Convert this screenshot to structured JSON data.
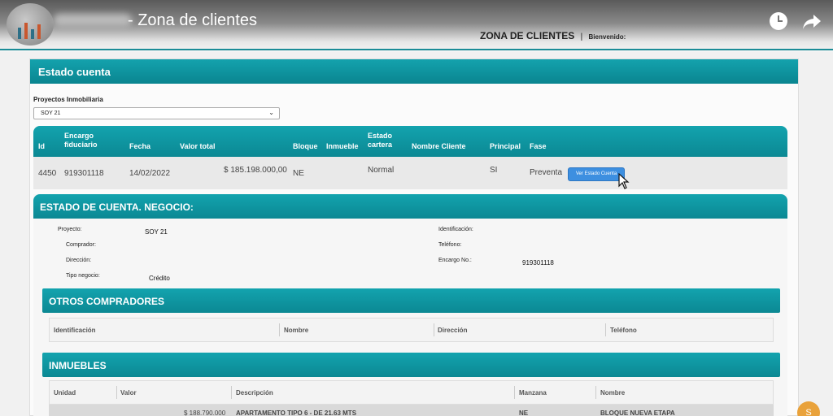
{
  "video": {
    "title": "- Zona de clientes"
  },
  "header": {
    "section": "ZONA DE CLIENTES",
    "separator": "|",
    "welcome": "Bienvenido:"
  },
  "card": {
    "title": "Estado cuenta",
    "projects_label": "Proyectos Inmobiliaria",
    "selected_project": "SOY 21"
  },
  "results": {
    "columns": [
      "Id",
      "Encargo fiduciario",
      "Fecha",
      "Valor total",
      "Bloque",
      "Inmueble",
      "Estado cartera",
      "Nombre Cliente",
      "Principal",
      "Fase"
    ],
    "row": {
      "id": "4450",
      "encargo": "919301118",
      "fecha": "14/02/2022",
      "valor": "$ 185.198.000,00",
      "bloque": "NE",
      "estado": "Normal",
      "principal": "SI",
      "fase": "Preventa"
    },
    "button": "Ver Estado Cuenta"
  },
  "estado": {
    "title": "ESTADO DE CUENTA. NEGOCIO:",
    "labels": {
      "proyecto": "Proyecto:",
      "comprador": "Comprador:",
      "direccion": "Dirección:",
      "tipo": "Tipo negocio:",
      "identificacion": "Identificación:",
      "telefono": "Teléfono:",
      "encargo": "Encargo No.:"
    },
    "values": {
      "proyecto": "SOY 21",
      "tipo": "Crédito",
      "encargo": "919301118"
    }
  },
  "otros": {
    "title": "OTROS COMPRADORES",
    "columns": [
      "Identificación",
      "Nombre",
      "Dirección",
      "Teléfono"
    ]
  },
  "inmuebles": {
    "title": "INMUEBLES",
    "columns": [
      "Unidad",
      "Valor",
      "Descripción",
      "Manzana",
      "Nombre"
    ],
    "row": {
      "valor": "$ 188.790.000",
      "descripcion": "APARTAMENTO TIPO 6 - DE 21.63 MTS",
      "manzana": "NE",
      "nombre": "BLOQUE NUEVA ETAPA"
    }
  },
  "badge": "S",
  "colors": {
    "teal": "#0b8893",
    "button": "#3d8fe0",
    "badge": "#e9a23b"
  }
}
